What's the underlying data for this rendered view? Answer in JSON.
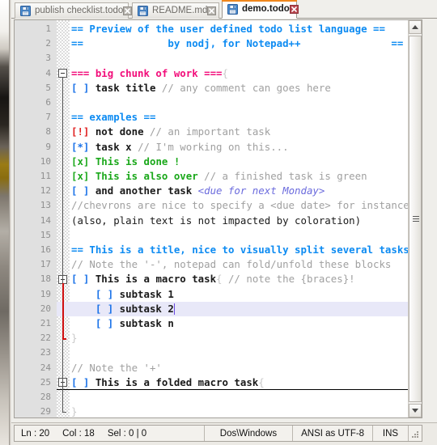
{
  "window": {
    "accent_orange": "#f0871c",
    "editor_bg": "#ffffff",
    "gutter_bg": "#e0e0e0",
    "current_line_bg": "#e8e8f8"
  },
  "tabs": [
    {
      "label": "publish checklist.todo",
      "icon": "save-disk-icon",
      "close_icon": "close-icon",
      "active": false
    },
    {
      "label": "README.md",
      "icon": "save-disk-icon",
      "close_icon": "close-icon",
      "active": false
    },
    {
      "label": "demo.todo",
      "icon": "save-disk-icon",
      "close_icon": "close-icon",
      "active": true
    }
  ],
  "editor": {
    "caret": {
      "line": 20,
      "column": 18
    },
    "lines": [
      {
        "n": "1",
        "segments": [
          {
            "text": "== Preview of the user defined todo list language ==",
            "cls": "t-head"
          }
        ]
      },
      {
        "n": "2",
        "segments": [
          {
            "text": "==              by nodj, for Notepad++               ==",
            "cls": "t-head"
          }
        ]
      },
      {
        "n": "3",
        "segments": []
      },
      {
        "n": "4",
        "segments": [
          {
            "text": "=== big chunk of work ===",
            "cls": "t-chunk"
          },
          {
            "text": "{",
            "cls": "t-brace"
          }
        ],
        "fold": "open"
      },
      {
        "n": "5",
        "segments": [
          {
            "text": "[ ]",
            "cls": "t-task"
          },
          {
            "text": " task title ",
            "cls": "t-taskbody"
          },
          {
            "text": "// any comment can goes here",
            "cls": "t-comment"
          }
        ]
      },
      {
        "n": "6",
        "segments": []
      },
      {
        "n": "7",
        "segments": [
          {
            "text": "== examples ==",
            "cls": "t-head"
          }
        ]
      },
      {
        "n": "8",
        "segments": [
          {
            "text": "[!]",
            "cls": "t-important"
          },
          {
            "text": " not done ",
            "cls": "t-taskbody"
          },
          {
            "text": "// an important task",
            "cls": "t-comment"
          }
        ]
      },
      {
        "n": "9",
        "segments": [
          {
            "text": "[*]",
            "cls": "t-wip"
          },
          {
            "text": " task x ",
            "cls": "t-taskbody"
          },
          {
            "text": "// I'm working on this...",
            "cls": "t-comment"
          }
        ]
      },
      {
        "n": "10",
        "segments": [
          {
            "text": "[x]",
            "cls": "t-done"
          },
          {
            "text": " This is done !",
            "cls": "t-done"
          }
        ]
      },
      {
        "n": "11",
        "segments": [
          {
            "text": "[x]",
            "cls": "t-done"
          },
          {
            "text": " This is also over ",
            "cls": "t-done"
          },
          {
            "text": "// a finished task is green",
            "cls": "t-comment"
          }
        ]
      },
      {
        "n": "12",
        "segments": [
          {
            "text": "[ ]",
            "cls": "t-task"
          },
          {
            "text": " and another task ",
            "cls": "t-taskbody"
          },
          {
            "text": "<due for next Monday>",
            "cls": "t-due"
          }
        ]
      },
      {
        "n": "13",
        "segments": [
          {
            "text": "//chevrons are nice to specify a <due date> for instance.",
            "cls": "t-comment"
          }
        ]
      },
      {
        "n": "14",
        "segments": [
          {
            "text": "(also, plain text is not impacted by coloration)",
            "cls": "t-plain"
          }
        ]
      },
      {
        "n": "15",
        "segments": []
      },
      {
        "n": "16",
        "segments": [
          {
            "text": "== This is a title, nice to visually split several tasks ==",
            "cls": "t-head"
          }
        ]
      },
      {
        "n": "17",
        "segments": [
          {
            "text": "// Note the '-', notepad can fold/unfold these blocks",
            "cls": "t-comment"
          }
        ]
      },
      {
        "n": "18",
        "segments": [
          {
            "text": "[ ]",
            "cls": "t-task"
          },
          {
            "text": " This is a macro task",
            "cls": "t-taskbody"
          },
          {
            "text": "{",
            "cls": "t-brace"
          },
          {
            "text": " // note the {braces}!",
            "cls": "t-comment"
          }
        ],
        "fold": "open-red"
      },
      {
        "n": "19",
        "segments": [
          {
            "text": "    [ ]",
            "cls": "t-task"
          },
          {
            "text": " subtask 1",
            "cls": "t-taskbody"
          }
        ]
      },
      {
        "n": "20",
        "segments": [
          {
            "text": "    [ ]",
            "cls": "t-task"
          },
          {
            "text": " subtask 2",
            "cls": "t-taskbody"
          }
        ],
        "current": true
      },
      {
        "n": "21",
        "segments": [
          {
            "text": "    [ ]",
            "cls": "t-task"
          },
          {
            "text": " subtask n",
            "cls": "t-taskbody"
          }
        ]
      },
      {
        "n": "22",
        "segments": [
          {
            "text": "}",
            "cls": "t-closebrace"
          }
        ],
        "fold": "end-red"
      },
      {
        "n": "23",
        "segments": []
      },
      {
        "n": "24",
        "segments": [
          {
            "text": "// Note the '+'",
            "cls": "t-comment"
          }
        ]
      },
      {
        "n": "25",
        "segments": [
          {
            "text": "[ ]",
            "cls": "t-task"
          },
          {
            "text": " This is a folded macro task",
            "cls": "t-taskbody"
          },
          {
            "text": "{",
            "cls": "t-brace"
          }
        ],
        "fold": "closed",
        "underline": true
      },
      {
        "n": "28",
        "segments": []
      },
      {
        "n": "29",
        "segments": [
          {
            "text": "}",
            "cls": "t-closebrace"
          }
        ],
        "fold": "end"
      }
    ]
  },
  "scrollbar": {
    "up_icon": "scroll-up-arrow-icon",
    "down_icon": "scroll-down-arrow-icon",
    "grip_icon": "scroll-thumb-grip-icon"
  },
  "statusbar": {
    "line_label": "Ln : 20",
    "col_label": "Col : 18",
    "sel_label": "Sel : 0 | 0",
    "eol": "Dos\\Windows",
    "encoding": "ANSI as UTF-8",
    "insert_mode": "INS"
  }
}
